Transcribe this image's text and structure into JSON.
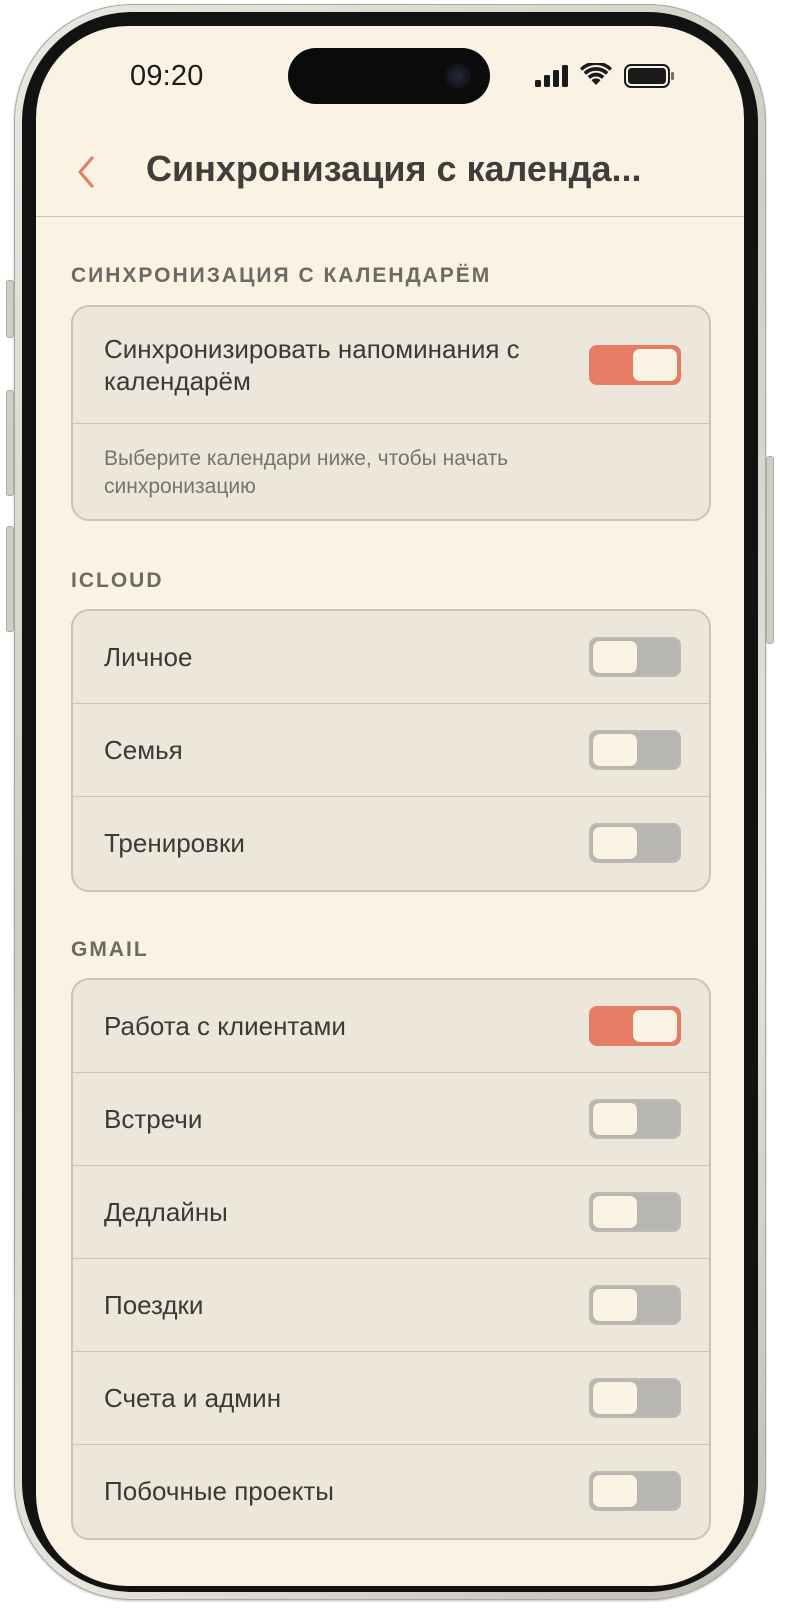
{
  "status_bar": {
    "time": "09:20"
  },
  "nav": {
    "title": "Синхронизация с календа..."
  },
  "sync_section": {
    "header": "СИНХРОНИЗАЦИЯ С КАЛЕНДАРЁМ",
    "toggle_label": "Синхронизировать напоминания с календарём",
    "toggle_on": true,
    "hint": "Выберите календари ниже, чтобы начать синхронизацию"
  },
  "icloud": {
    "header": "ICLOUD",
    "items": [
      {
        "label": "Личное",
        "on": false
      },
      {
        "label": "Семья",
        "on": false
      },
      {
        "label": "Тренировки",
        "on": false
      }
    ]
  },
  "gmail": {
    "header": "GMAIL",
    "items": [
      {
        "label": "Работа с клиентами",
        "on": true
      },
      {
        "label": "Встречи",
        "on": false
      },
      {
        "label": "Дедлайны",
        "on": false
      },
      {
        "label": "Поездки",
        "on": false
      },
      {
        "label": "Счета и админ",
        "on": false
      },
      {
        "label": "Побочные проекты",
        "on": false
      }
    ]
  },
  "colors": {
    "accent": "#e57c64",
    "background": "#faf3e4",
    "card": "#ede6da",
    "toggle_off": "#b8b6b1"
  }
}
